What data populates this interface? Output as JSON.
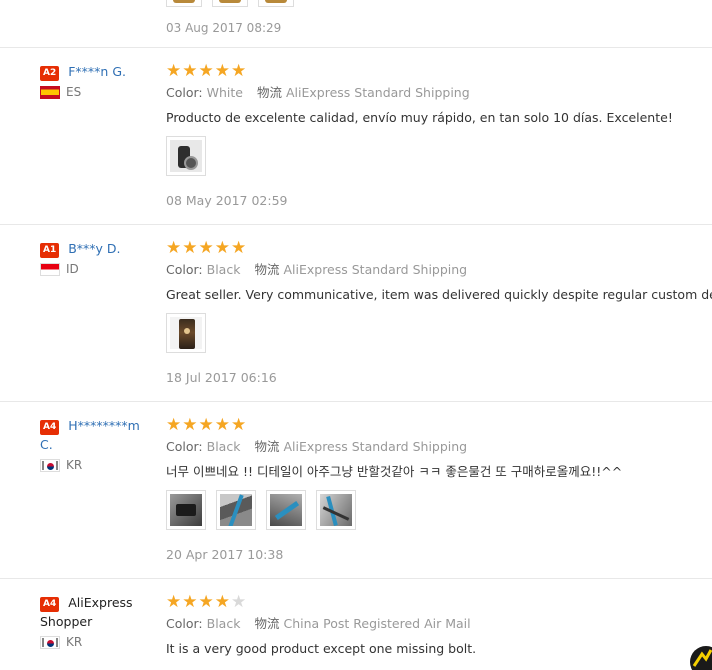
{
  "top_review": {
    "date": "03 Aug 2017 08:29",
    "photos": 3
  },
  "labels": {
    "color": "Color:",
    "logistics": "物流"
  },
  "reviews": [
    {
      "level": "A2",
      "name": "F****n G.",
      "country": "ES",
      "flag": "es",
      "rating": 5,
      "color": "White",
      "shipping": "AliExpress Standard Shipping",
      "text": "Producto de excelente calidad, envío muy rápido, en tan solo 10 días. Excelente!",
      "photos": [
        "bike-part-photo"
      ],
      "date": "08 May 2017 02:59"
    },
    {
      "level": "A1",
      "name": "B***y D.",
      "country": "ID",
      "flag": "id",
      "rating": 5,
      "color": "Black",
      "shipping": "AliExpress Standard Shipping",
      "text": "Great seller. Very communicative, item was delivered quickly despite regular custom delays",
      "photos": [
        "product-photo"
      ],
      "date": "18 Jul 2017 06:16"
    },
    {
      "level": "A4",
      "name": "H********m C.",
      "country": "KR",
      "flag": "kr",
      "rating": 5,
      "color": "Black",
      "shipping": "AliExpress Standard Shipping",
      "text": "너무 이쁘네요 !! 디테일이 아주그냥 반할것같아 ㅋㅋ 좋은물건 또 구매하로올께요!!^^",
      "photos": [
        "part-photo",
        "frame-photo",
        "frame-detail-photo",
        "bike-photo"
      ],
      "date": "20 Apr 2017 10:38"
    },
    {
      "level": "A4",
      "name": "AliExpress Shopper",
      "name_style": "dark",
      "country": "KR",
      "flag": "kr",
      "rating": 4,
      "color": "Black",
      "shipping": "China Post Registered Air Mail",
      "text": "It is a very good product except one missing bolt.",
      "photos": [],
      "date": ""
    }
  ],
  "colors": {
    "star_on": "#f5a623",
    "star_off": "#d9d9d9",
    "level_badge": "#e62e04",
    "buyer_link": "#2f6fb4",
    "muted": "#999999",
    "divider": "#e8e8e8"
  }
}
